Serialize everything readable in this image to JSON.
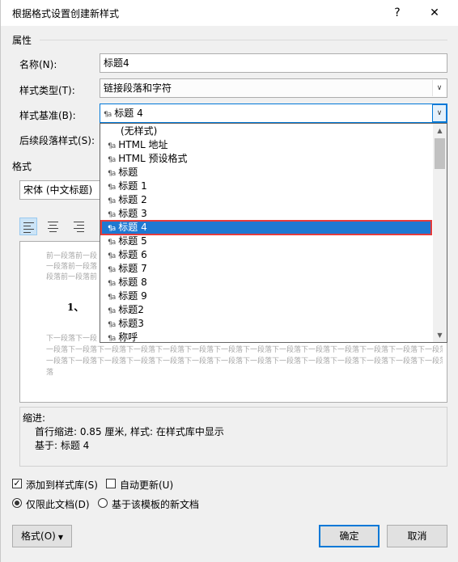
{
  "window": {
    "title": "根据格式设置创建新样式",
    "help_label": "?",
    "close_label": "✕"
  },
  "properties": {
    "section_label": "属性",
    "name_label": "名称(N):",
    "name_value": "标题4",
    "style_type_label": "样式类型(T):",
    "style_type_value": "链接段落和字符",
    "based_on_label": "样式基准(B):",
    "based_on_value": "标题 4",
    "next_style_label": "后续段落样式(S):"
  },
  "format": {
    "section_label": "格式",
    "font_value": "宋体 (中文标题)"
  },
  "dropdown": {
    "items": [
      {
        "label": "(无样式)",
        "icon": ""
      },
      {
        "label": "HTML 地址",
        "icon": "¶a"
      },
      {
        "label": "HTML 预设格式",
        "icon": "¶a"
      },
      {
        "label": "标题",
        "icon": "¶a"
      },
      {
        "label": "标题 1",
        "icon": "¶a"
      },
      {
        "label": "标题 2",
        "icon": "¶a"
      },
      {
        "label": "标题 3",
        "icon": "¶a"
      },
      {
        "label": "标题 4",
        "icon": "¶a"
      },
      {
        "label": "标题 5",
        "icon": "¶a"
      },
      {
        "label": "标题 6",
        "icon": "¶a"
      },
      {
        "label": "标题 7",
        "icon": "¶a"
      },
      {
        "label": "标题 8",
        "icon": "¶a"
      },
      {
        "label": "标题 9",
        "icon": "¶a"
      },
      {
        "label": "标题2",
        "icon": "¶a"
      },
      {
        "label": "标题3",
        "icon": "¶a"
      },
      {
        "label": "称呼",
        "icon": "¶a"
      }
    ],
    "selected_index": 7
  },
  "preview": {
    "prev_para_1": "前一段落前一段",
    "prev_para_2": "一段落前一段落",
    "prev_para_3": "段落前一段落前",
    "heading_text": "1、",
    "next_para_1": "下一段落下一段",
    "next_para_2": "一段落下一段落下一段落下一段落下一段落下一段落下一段落下一段落下一段落下一段落下一段落下一段落下一段落下一段落下一",
    "next_para_3": "一段落下一段落下一段落下一段落下一段落下一段落下一段落下一段落下一段落下一段落下一段落下一段落下一段落下一段落下一",
    "next_para_4": "落"
  },
  "description": {
    "indent_label": "缩进:",
    "line1": "首行缩进:  0.85 厘米, 样式: 在样式库中显示",
    "line2": "基于: 标题 4"
  },
  "options": {
    "add_to_gallery": "添加到样式库(S)",
    "auto_update": "自动更新(U)",
    "only_this_doc": "仅限此文档(D)",
    "new_docs_template": "基于该模板的新文档"
  },
  "buttons": {
    "format": "格式(O)",
    "ok": "确定",
    "cancel": "取消"
  }
}
